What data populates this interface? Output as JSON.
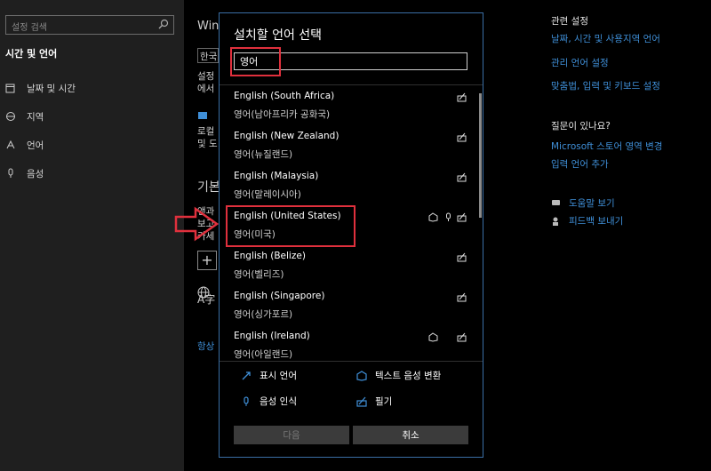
{
  "sidebar": {
    "search_placeholder": "설정 검색",
    "section_title": "시간 및 언어",
    "items": [
      {
        "label": "날짜 및 시간",
        "icon": "calendar-clock-icon"
      },
      {
        "label": "지역",
        "icon": "globe-region-icon"
      },
      {
        "label": "언어",
        "icon": "language-icon"
      },
      {
        "label": "음성",
        "icon": "microphone-icon"
      }
    ]
  },
  "background": {
    "snippets": [
      "Win",
      "한국",
      "설정",
      "에서",
      "로컬",
      "및 도",
      "기본",
      "앤과",
      "보고",
      "카세",
      "A字",
      "항상"
    ]
  },
  "right_panel": {
    "related_title": "관련 설정",
    "related_links": [
      "날짜, 시간 및 사용지역 언어",
      "관리 언어 설정",
      "맞춤법, 입력 및 키보드 설정"
    ],
    "question_title": "질문이 있나요?",
    "question_links": [
      "Microsoft 스토어 영역 변경",
      "입력 언어 추가"
    ],
    "help_link": "도움말 보기",
    "feedback_link": "피드백 보내기"
  },
  "dialog": {
    "title": "설치할 언어 선택",
    "search_value": "영어",
    "languages": [
      {
        "name": "English (South Africa)",
        "native": "영어(남아프리카 공화국)",
        "features": [
          "handwriting-icon"
        ]
      },
      {
        "name": "English (New Zealand)",
        "native": "영어(뉴질랜드)",
        "features": [
          "handwriting-icon"
        ]
      },
      {
        "name": "English (Malaysia)",
        "native": "영어(말레이시아)",
        "features": [
          "handwriting-icon"
        ]
      },
      {
        "name": "English (United States)",
        "native": "영어(미국)",
        "features": [
          "text-to-speech-icon",
          "speech-recognition-icon",
          "handwriting-icon"
        ]
      },
      {
        "name": "English (Belize)",
        "native": "영어(벨리즈)",
        "features": [
          "handwriting-icon"
        ]
      },
      {
        "name": "English (Singapore)",
        "native": "영어(싱가포르)",
        "features": [
          "handwriting-icon"
        ]
      },
      {
        "name": "English (Ireland)",
        "native": "영어(아일랜드)",
        "features": [
          "text-to-speech-icon",
          "handwriting-icon"
        ]
      }
    ],
    "legend": {
      "display_language": "표시 언어",
      "text_to_speech": "텍스트 음성 변환",
      "speech_recognition": "음성 인식",
      "handwriting": "필기"
    },
    "next_label": "다음",
    "cancel_label": "취소"
  },
  "colors": {
    "accent": "#3f8fd8",
    "highlight": "#e0303d",
    "dialog_border": "#3a6ea5"
  }
}
